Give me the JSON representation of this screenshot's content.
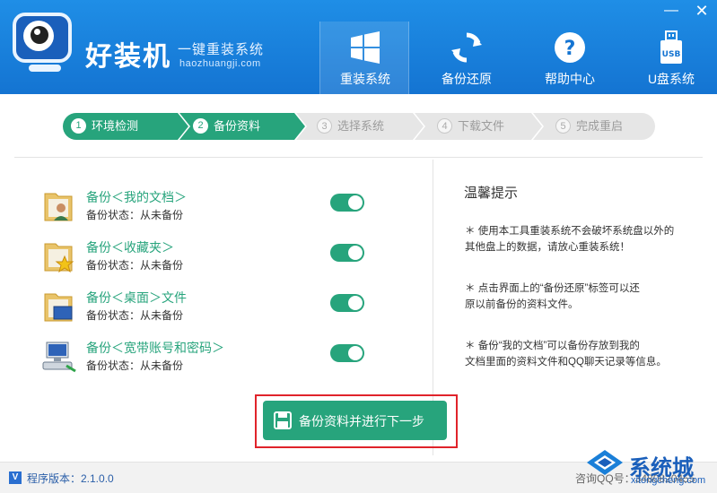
{
  "app": {
    "name": "好装机",
    "tagline": "一键重装系统",
    "domain": "haozhuangji.com"
  },
  "window": {
    "minimize_icon": "minimize-icon",
    "close_icon": "close-icon"
  },
  "nav": [
    {
      "label": "重装系统",
      "icon": "windows-icon",
      "active": true
    },
    {
      "label": "备份还原",
      "icon": "refresh-icon",
      "active": false
    },
    {
      "label": "帮助中心",
      "icon": "help-icon",
      "active": false
    },
    {
      "label": "U盘系统",
      "icon": "usb-icon",
      "usb_text": "USB",
      "active": false
    }
  ],
  "steps": [
    {
      "num": "1",
      "label": "环境检测",
      "state": "done"
    },
    {
      "num": "2",
      "label": "备份资料",
      "state": "current"
    },
    {
      "num": "3",
      "label": "选择系统",
      "state": "todo"
    },
    {
      "num": "4",
      "label": "下载文件",
      "state": "todo"
    },
    {
      "num": "5",
      "label": "完成重启",
      "state": "todo"
    }
  ],
  "backup_items": [
    {
      "title": "备份＜我的文档＞",
      "status": "备份状态：从未备份",
      "enabled": true,
      "icon": "user-folder-icon"
    },
    {
      "title": "备份＜收藏夹＞",
      "status": "备份状态：从未备份",
      "enabled": true,
      "icon": "favorites-folder-icon"
    },
    {
      "title": "备份＜桌面＞文件",
      "status": "备份状态：从未备份",
      "enabled": true,
      "icon": "desktop-folder-icon"
    },
    {
      "title": "备份＜宽带账号和密码＞",
      "status": "备份状态：从未备份",
      "enabled": true,
      "icon": "network-icon"
    }
  ],
  "tips": {
    "title": "温馨提示",
    "items": [
      {
        "line1": "＊ 使用本工具重装系统不会破坏系统盘以外的",
        "line2": "其他盘上的数据，请放心重装系统！"
      },
      {
        "line1": "＊ 点击界面上的“备份还原”标签可以还",
        "line2": "原以前备份的资料文件。"
      },
      {
        "line1": "＊ 备份“我的文档”可以备份存放到我的",
        "line2": "文档里面的资料文件和QQ聊天记录等信息。"
      }
    ]
  },
  "action": {
    "label": "备份资料并进行下一步",
    "icon": "floppy-disk-icon"
  },
  "footer": {
    "version_badge": "V",
    "version": "程序版本：2.1.0.0",
    "contact": "咨询QQ号：3480820455"
  },
  "watermark": {
    "name": "系统城",
    "domain": "xitongcheng.com"
  },
  "colors": {
    "header": "#1474d2",
    "accent": "#27a47c",
    "highlight_border": "#e0232b"
  }
}
